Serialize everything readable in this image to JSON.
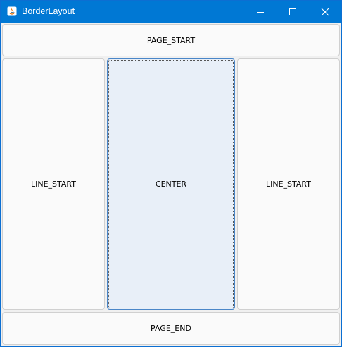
{
  "window": {
    "title": "BorderLayout"
  },
  "titlebar": {
    "icons": [
      "java-app-icon",
      "minimize-icon",
      "maximize-icon",
      "close-icon"
    ]
  },
  "layout": {
    "page_start": "PAGE_START",
    "line_start": "LINE_START",
    "center": "CENTER",
    "line_end_label": "LINE_START",
    "page_end": "PAGE_END"
  },
  "colors": {
    "titlebar": "#0078d4",
    "focused_button": "#e8eff8",
    "button": "#fafafa"
  }
}
